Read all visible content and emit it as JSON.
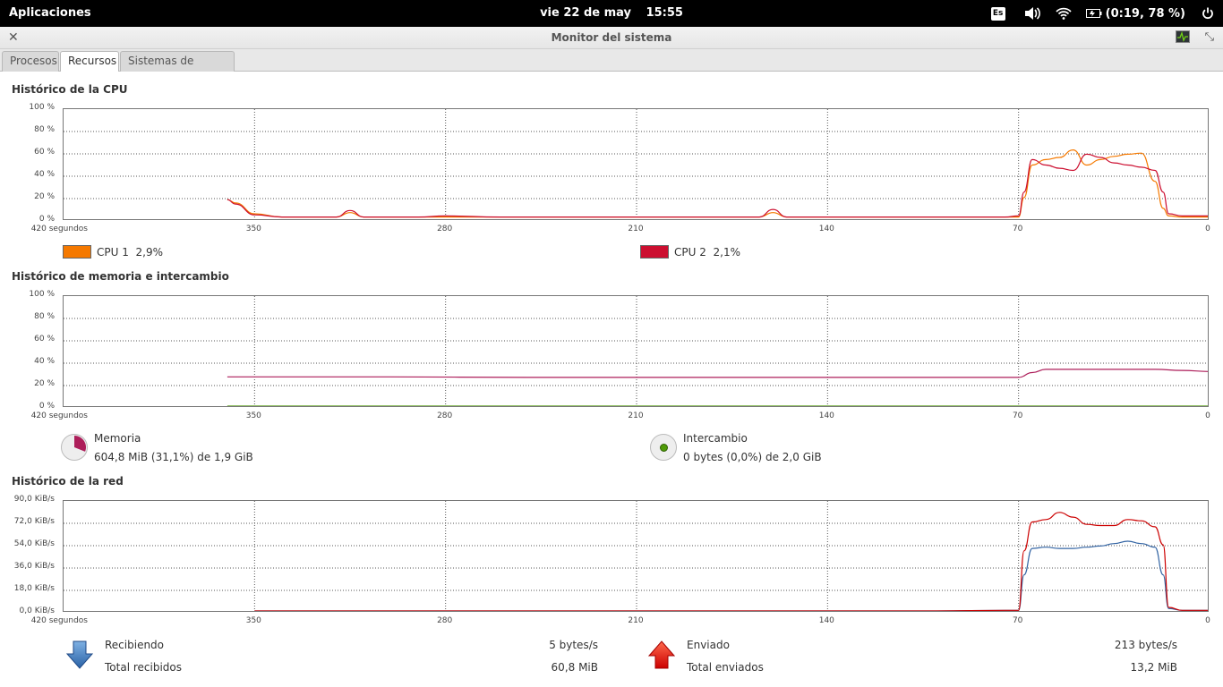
{
  "panel": {
    "apps_label": "Aplicaciones",
    "date": "vie 22 de may",
    "time": "15:55",
    "keyboard": "Es",
    "battery_text": "(0:19, 78 %)"
  },
  "window": {
    "title": "Monitor del sistema"
  },
  "tabs": [
    {
      "label": "Procesos",
      "active": false
    },
    {
      "label": "Recursos",
      "active": true
    },
    {
      "label": "Sistemas de archivos",
      "active": false
    }
  ],
  "x_ticks": [
    "420 segundos",
    "350",
    "280",
    "210",
    "140",
    "70",
    "0"
  ],
  "cpu": {
    "title": "Histórico de la CPU",
    "y_ticks": [
      "100 %",
      "80 %",
      "60 %",
      "40 %",
      "20 %",
      "0 %"
    ],
    "legend": [
      {
        "label": "CPU 1",
        "value": "2,9%",
        "color": "#f57900"
      },
      {
        "label": "CPU 2",
        "value": "2,1%",
        "color": "#cc0f30"
      }
    ]
  },
  "memory": {
    "title": "Histórico de memoria e intercambio",
    "y_ticks": [
      "100 %",
      "80 %",
      "60 %",
      "40 %",
      "20 %",
      "0 %"
    ],
    "mem_label": "Memoria",
    "mem_value": "604,8 MiB (31,1%) de 1,9 GiB",
    "mem_color": "#ad1e5a",
    "swap_label": "Intercambio",
    "swap_value": "0 bytes (0,0%) de 2,0 GiB",
    "swap_color": "#4e9a06"
  },
  "network": {
    "title": "Histórico de la red",
    "y_ticks": [
      "90,0 KiB/s",
      "72,0 KiB/s",
      "54,0 KiB/s",
      "36,0 KiB/s",
      "18,0 KiB/s",
      "0,0 KiB/s"
    ],
    "receiving_label": "Recibiendo",
    "receiving_value": "5 bytes/s",
    "total_received_label": "Total recibidos",
    "total_received_value": "60,8 MiB",
    "sending_label": "Enviado",
    "sending_value": "213 bytes/s",
    "total_sent_label": "Total enviados",
    "total_sent_value": "13,2 MiB",
    "recv_color": "#3465a4",
    "send_color": "#cc0000"
  },
  "chart_data": [
    {
      "type": "line",
      "x_unit_label": "segundos",
      "xlim": [
        420,
        0
      ],
      "ylim": [
        0,
        100
      ],
      "series": [
        {
          "name": "CPU 1",
          "x": [
            360,
            357,
            350,
            340,
            330,
            320,
            315,
            310,
            300,
            290,
            280,
            260,
            240,
            220,
            200,
            180,
            165,
            160,
            155,
            150,
            140,
            120,
            100,
            90,
            80,
            75,
            70,
            68,
            65,
            60,
            55,
            50,
            45,
            40,
            35,
            30,
            25,
            20,
            17,
            15,
            10,
            5,
            0
          ],
          "y": [
            18,
            15,
            5,
            2,
            2,
            2,
            6,
            2,
            2,
            2,
            2,
            2,
            2,
            2,
            2,
            2,
            2,
            6,
            2,
            2,
            2,
            2,
            2,
            2,
            2,
            2,
            2,
            20,
            50,
            55,
            57,
            64,
            50,
            55,
            58,
            60,
            61,
            35,
            10,
            3,
            2,
            2,
            2
          ]
        },
        {
          "name": "CPU 2",
          "x": [
            360,
            357,
            350,
            340,
            330,
            320,
            315,
            310,
            300,
            290,
            280,
            260,
            240,
            220,
            200,
            180,
            165,
            160,
            155,
            150,
            140,
            120,
            100,
            90,
            80,
            75,
            70,
            68,
            65,
            60,
            55,
            50,
            45,
            40,
            35,
            30,
            25,
            20,
            17,
            15,
            10,
            5,
            0
          ],
          "y": [
            18,
            14,
            4,
            2,
            2,
            2,
            8,
            2,
            2,
            2,
            3,
            2,
            2,
            2,
            2,
            2,
            2,
            9,
            2,
            2,
            2,
            2,
            2,
            2,
            2,
            2,
            3,
            25,
            55,
            50,
            47,
            45,
            60,
            57,
            52,
            50,
            48,
            45,
            25,
            5,
            3,
            3,
            3
          ]
        }
      ]
    },
    {
      "type": "line",
      "xlim": [
        420,
        0
      ],
      "ylim": [
        0,
        100
      ],
      "series": [
        {
          "name": "Memoria",
          "x": [
            360,
            300,
            250,
            200,
            150,
            100,
            75,
            70,
            65,
            60,
            50,
            40,
            30,
            20,
            10,
            0
          ],
          "y": [
            27,
            27,
            26.5,
            26.5,
            26.5,
            26.5,
            26.5,
            26.5,
            31,
            34,
            34,
            34,
            34,
            34,
            33,
            32
          ]
        },
        {
          "name": "Intercambio",
          "x": [
            360,
            0
          ],
          "y": [
            0,
            0
          ]
        }
      ]
    },
    {
      "type": "line",
      "xlim": [
        420,
        0
      ],
      "ylim": [
        0,
        90
      ],
      "series": [
        {
          "name": "Recibiendo",
          "x": [
            350,
            300,
            200,
            100,
            75,
            70,
            68,
            65,
            60,
            55,
            50,
            45,
            40,
            35,
            30,
            25,
            20,
            17,
            15,
            10,
            5,
            0
          ],
          "y": [
            0,
            0,
            0,
            0,
            0.5,
            0.5,
            30,
            52,
            53,
            52,
            52,
            53,
            54,
            56,
            58,
            56,
            53,
            30,
            2,
            0.5,
            0.5,
            0.5
          ]
        },
        {
          "name": "Enviado",
          "x": [
            350,
            300,
            200,
            100,
            75,
            70,
            68,
            65,
            60,
            55,
            50,
            45,
            40,
            35,
            30,
            25,
            20,
            17,
            15,
            10,
            5,
            0
          ],
          "y": [
            0,
            0,
            0,
            0,
            0.5,
            0.5,
            50,
            74,
            76,
            82,
            78,
            72,
            71,
            71,
            76,
            75,
            70,
            55,
            3,
            0.5,
            0.5,
            0.5
          ]
        }
      ]
    }
  ]
}
